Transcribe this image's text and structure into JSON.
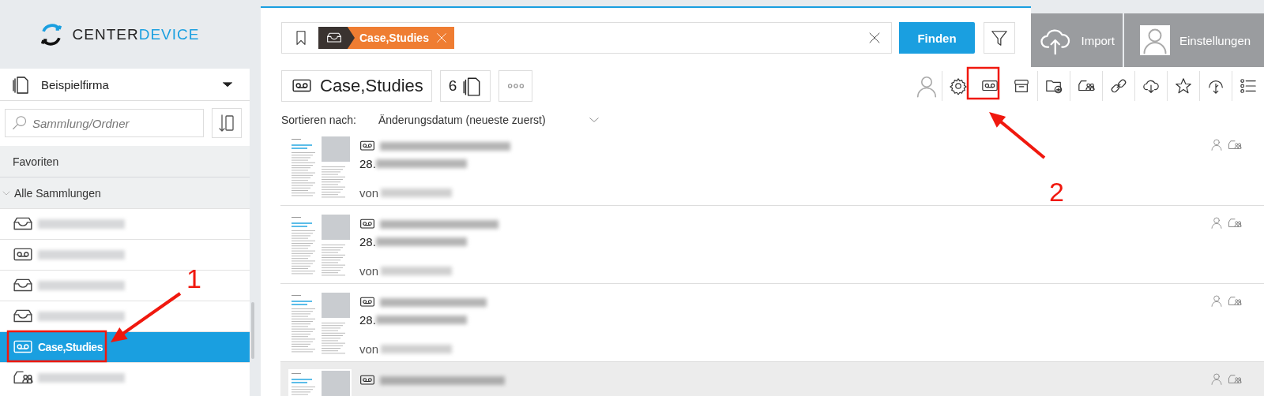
{
  "logo": {
    "word_1": "CENTER",
    "word_2": "DEVICE"
  },
  "sidebar": {
    "workspace": "Beispielfirma",
    "search": {
      "placeholder": "Sammlung/Ordner"
    },
    "favorites": "Favoriten",
    "collections": {
      "label": "Alle Sammlungen",
      "expanded": true,
      "items": [
        {
          "kind": "inbox",
          "selected": false
        },
        {
          "kind": "tape",
          "selected": false
        },
        {
          "kind": "inbox",
          "selected": false
        },
        {
          "kind": "inbox",
          "selected": false
        },
        {
          "kind": "tape",
          "selected": true,
          "label": "Case,Studies"
        },
        {
          "kind": "shared",
          "selected": false
        }
      ]
    }
  },
  "search": {
    "tag": "Case,Studies",
    "button": "Finden"
  },
  "header_buttons": [
    {
      "kind": "import",
      "label": "Import"
    },
    {
      "kind": "profile",
      "label": "Einstellungen"
    }
  ],
  "collection": {
    "title": "Case,Studies",
    "count": "6"
  },
  "sort": {
    "label": "Sortieren nach:",
    "value": "Änderungsdatum (neueste zuerst)"
  },
  "documents": [
    {
      "date": "28.",
      "author_prefix": "von",
      "hovered": false
    },
    {
      "date": "28.",
      "author_prefix": "von",
      "hovered": false
    },
    {
      "date": "28.",
      "author_prefix": "von",
      "hovered": false
    },
    {
      "hovered": true
    }
  ],
  "annotations": [
    {
      "number": "1"
    },
    {
      "number": "2"
    }
  ]
}
